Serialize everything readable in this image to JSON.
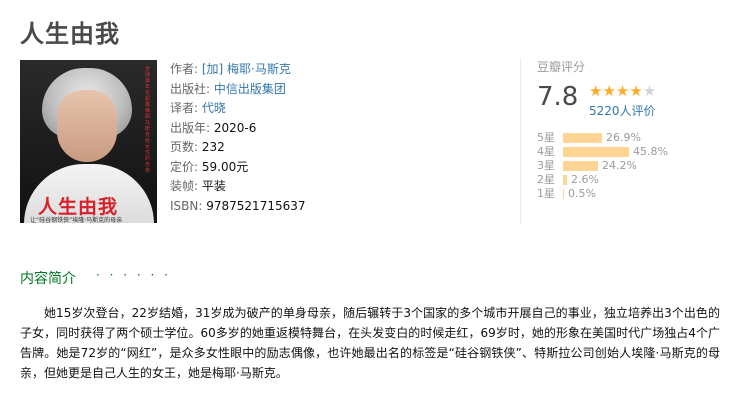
{
  "book": {
    "title": "人生由我",
    "cover": {
      "title": "人生由我",
      "subtitle": "让“硅谷钢铁侠”埃隆·马斯克的母亲",
      "spine": "全球最年长超模梅耶·马斯克给女性的自传"
    },
    "info": {
      "author_label": "作者:",
      "author": "[加] 梅耶·马斯克",
      "publisher_label": "出版社:",
      "publisher": "中信出版集团",
      "translator_label": "译者:",
      "translator": "代晓",
      "pubdate_label": "出版年:",
      "pubdate": "2020-6",
      "pages_label": "页数:",
      "pages": "232",
      "price_label": "定价:",
      "price": "59.00元",
      "binding_label": "装帧:",
      "binding": "平装",
      "isbn_label": "ISBN:",
      "isbn": "9787521715637"
    }
  },
  "rating": {
    "heading": "豆瓣评分",
    "score": "7.8",
    "stars_value": 4,
    "votes": "5220人评价",
    "distribution": [
      {
        "label": "5星",
        "percent": "26.9%",
        "value": 26.9
      },
      {
        "label": "4星",
        "percent": "45.8%",
        "value": 45.8
      },
      {
        "label": "3星",
        "percent": "24.2%",
        "value": 24.2
      },
      {
        "label": "2星",
        "percent": "2.6%",
        "value": 2.6
      },
      {
        "label": "1星",
        "percent": "0.5%",
        "value": 0.5
      }
    ]
  },
  "intro": {
    "heading": "内容简介",
    "dots": "· · · · · ·",
    "text": "她15岁次登台，22岁结婚，31岁成为破产的单身母亲，随后辗转于3个国家的多个城市开展自己的事业，独立培养出3个出色的子女，同时获得了两个硕士学位。60多岁的她重返模特舞台，在头发变白的时候走红，69岁时，她的形象在美国时代广场独占4个广告牌。她是72岁的“网红”，是众多女性眼中的励志偶像，也许她最出名的标签是“硅谷钢铁侠”、特斯拉公司创始人埃隆·马斯克的母亲，但她更是自己人生的女王，她是梅耶·马斯克。"
  },
  "colors": {
    "link": "#3377aa",
    "green": "#007722",
    "star": "#ffac2d",
    "bar": "#ffd596"
  }
}
